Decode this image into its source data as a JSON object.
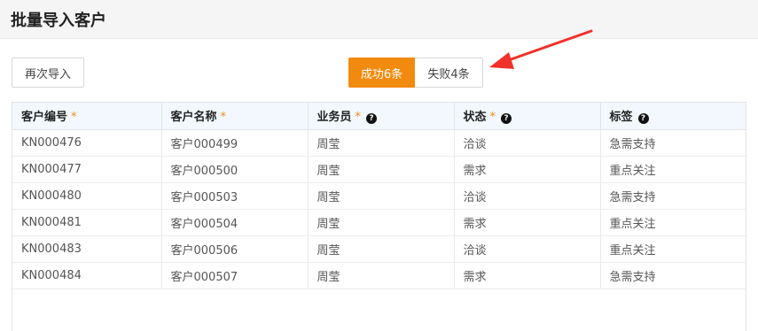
{
  "page": {
    "title": "批量导入客户"
  },
  "toolbar": {
    "reimport_label": "再次导入",
    "success_tab_label": "成功6条",
    "fail_tab_label": "失败4条"
  },
  "colors": {
    "accent": "#f28a0f",
    "header_bg": "#f2f8fd",
    "annotation_arrow": "#f0312a"
  },
  "table": {
    "columns": [
      {
        "label": "客户编号",
        "required": "*"
      },
      {
        "label": "客户名称",
        "required": "*"
      },
      {
        "label": "业务员",
        "required": "*",
        "help": "?"
      },
      {
        "label": "状态",
        "required": "*",
        "help": "?"
      },
      {
        "label": "标签",
        "help": "?"
      }
    ],
    "rows": [
      [
        "KN000476",
        "客户000499",
        "周莹",
        "洽谈",
        "急需支持"
      ],
      [
        "KN000477",
        "客户000500",
        "周莹",
        "需求",
        "重点关注"
      ],
      [
        "KN000480",
        "客户000503",
        "周莹",
        "洽谈",
        "急需支持"
      ],
      [
        "KN000481",
        "客户000504",
        "周莹",
        "需求",
        "重点关注"
      ],
      [
        "KN000483",
        "客户000506",
        "周莹",
        "洽谈",
        "重点关注"
      ],
      [
        "KN000484",
        "客户000507",
        "周莹",
        "需求",
        "急需支持"
      ]
    ]
  }
}
